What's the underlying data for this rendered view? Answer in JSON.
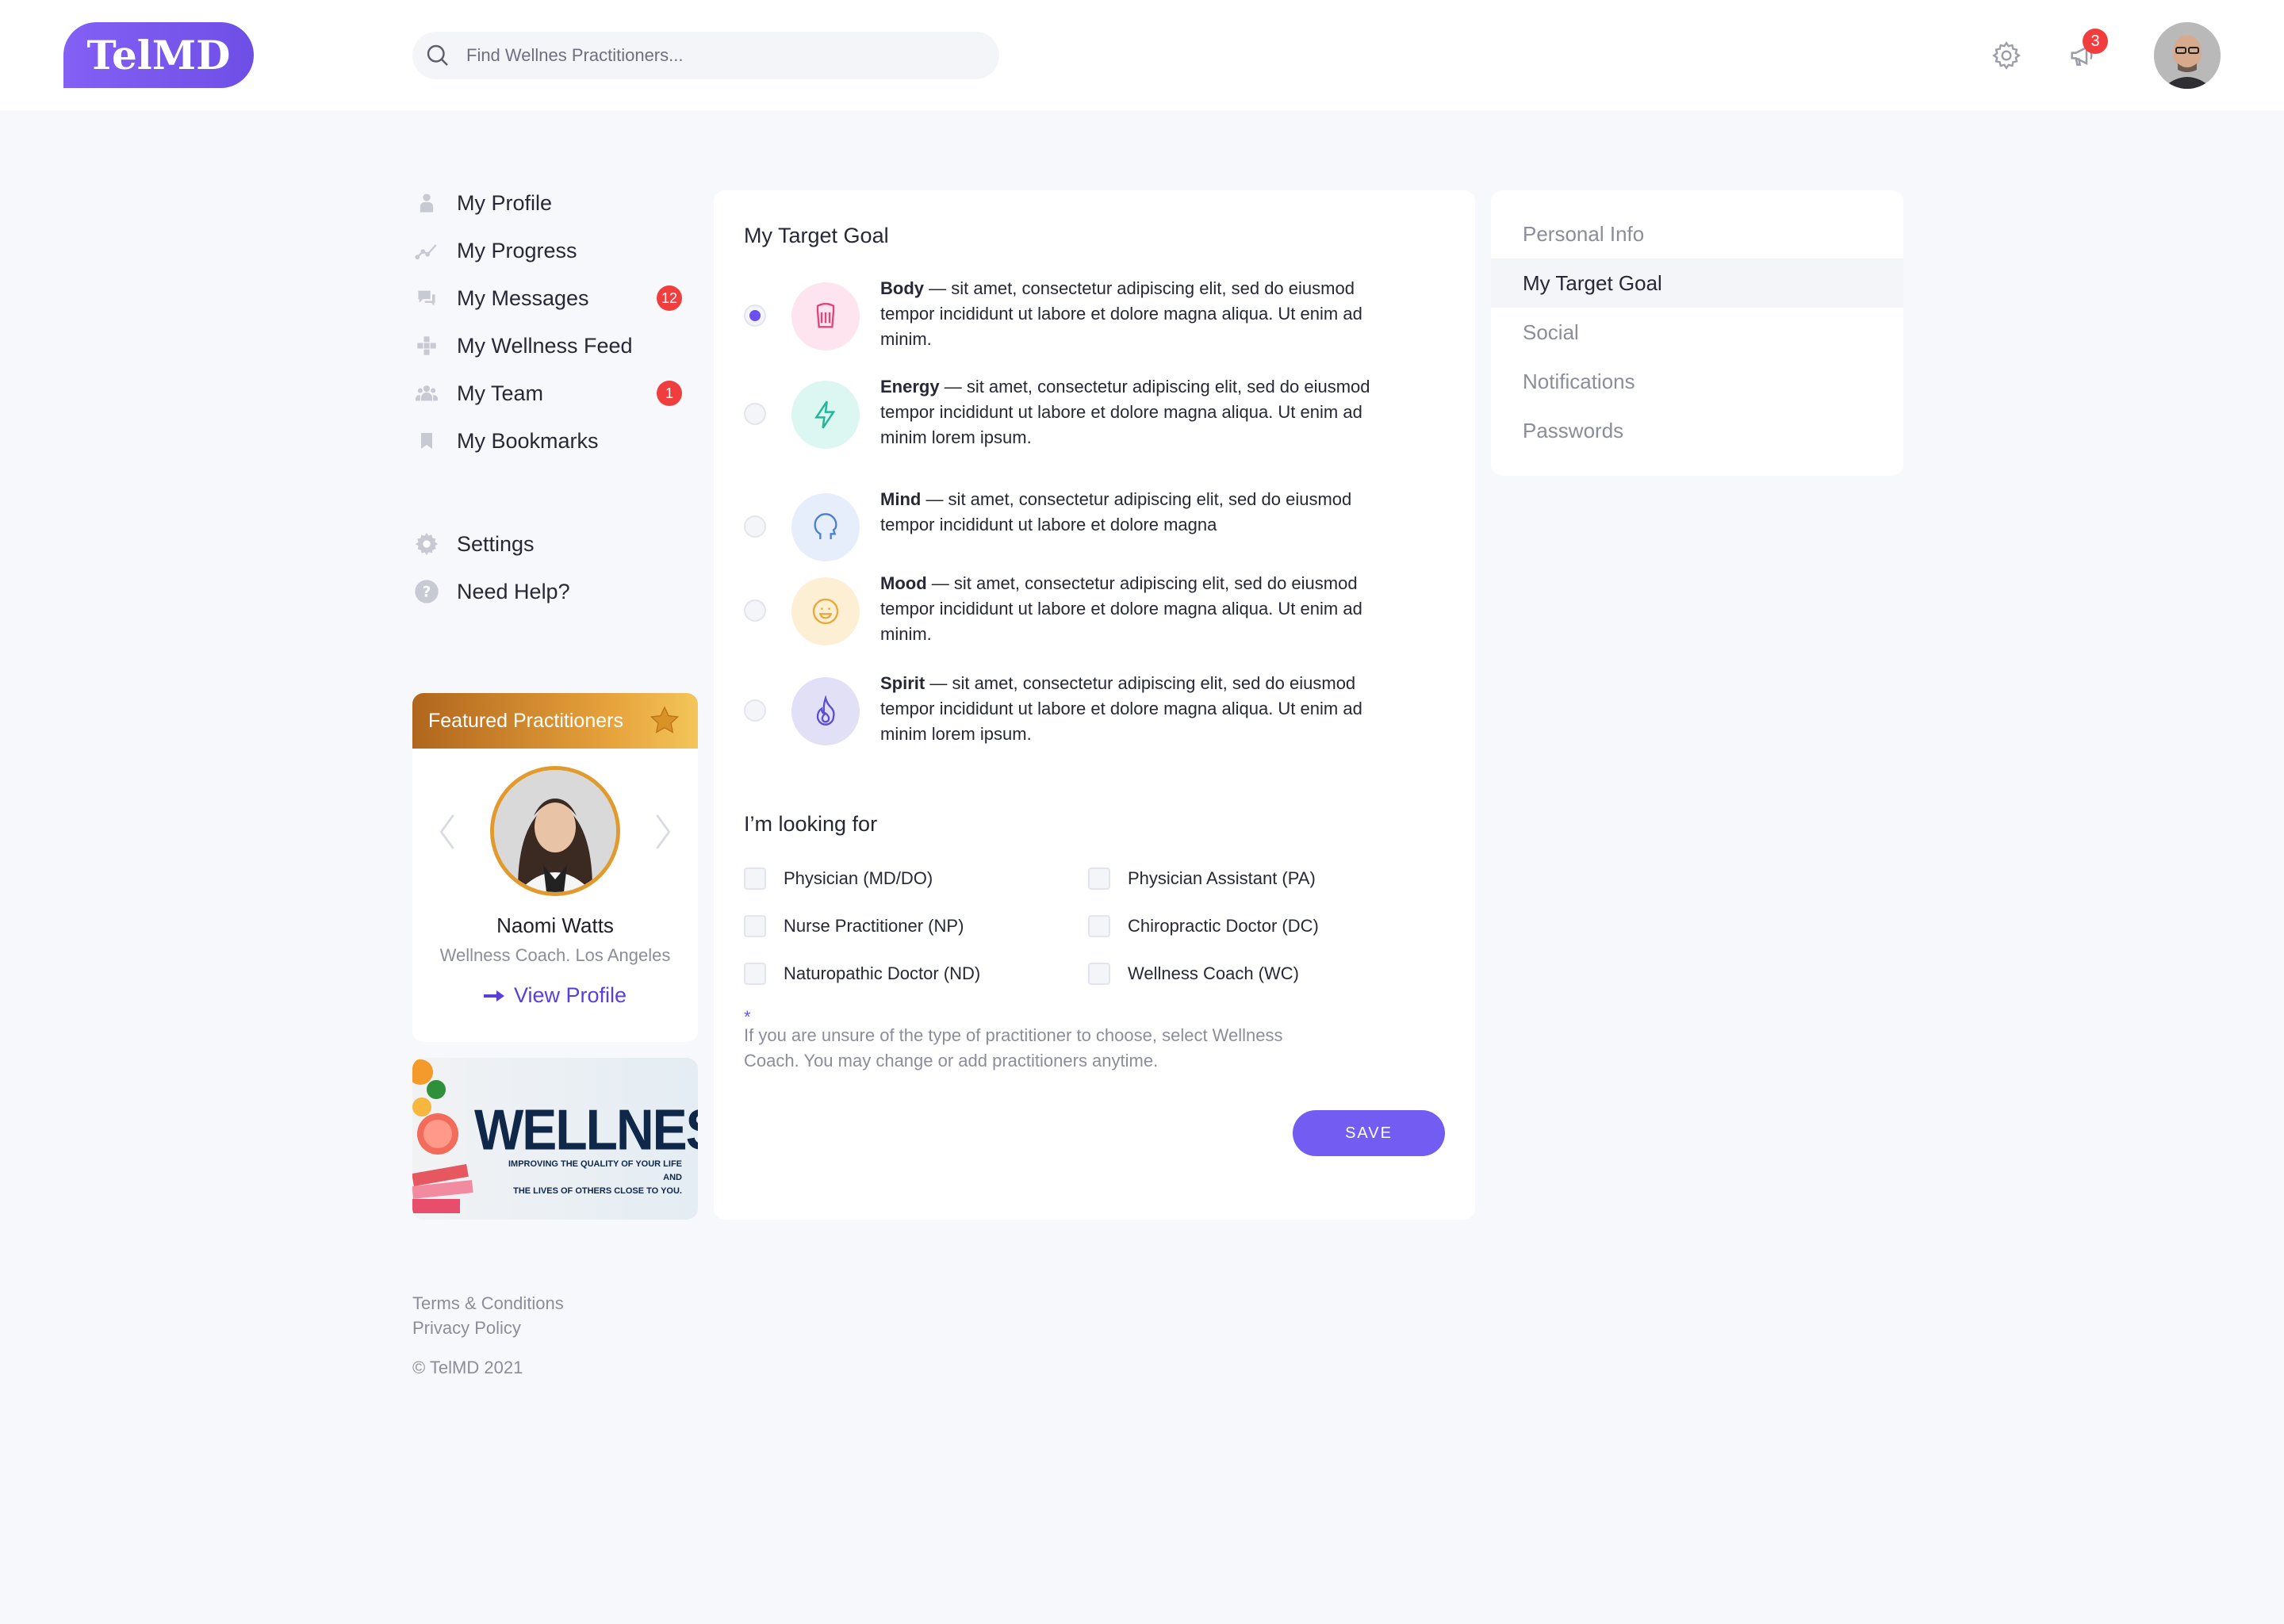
{
  "header": {
    "logo": "TelMD",
    "search_placeholder": "Find Wellnes Practitioners...",
    "notification_count": "3"
  },
  "nav": {
    "items": [
      {
        "label": "My Profile",
        "icon": "person-icon"
      },
      {
        "label": "My Progress",
        "icon": "chart-line-icon"
      },
      {
        "label": "My Messages",
        "icon": "chat-icon",
        "count": "12"
      },
      {
        "label": "My Wellness Feed",
        "icon": "feed-icon"
      },
      {
        "label": "My Team",
        "icon": "team-icon",
        "count": "1"
      },
      {
        "label": "My Bookmarks",
        "icon": "bookmark-icon"
      }
    ],
    "secondary": [
      {
        "label": "Settings",
        "icon": "gear-icon"
      },
      {
        "label": "Need Help?",
        "icon": "help-icon"
      }
    ]
  },
  "featured": {
    "title": "Featured Practitioners",
    "name": "Naomi Watts",
    "subtitle": "Wellness Coach. Los Angeles",
    "view_profile": "View Profile"
  },
  "banner": {
    "word": "WELLNESS",
    "tagline_1": "IMPROVING THE QUALITY OF YOUR LIFE AND",
    "tagline_2": "THE LIVES OF OTHERS CLOSE TO YOU."
  },
  "footer": {
    "terms": "Terms & Conditions",
    "privacy": "Privacy Policy",
    "copyright": "© TelMD 2021"
  },
  "main": {
    "title": "My Target Goal",
    "goals": [
      {
        "name": "Body",
        "text": " — sit amet, consectetur adipiscing elit, sed do eiusmod tempor incididunt ut labore et dolore magna aliqua. Ut enim ad minim.",
        "selected": true,
        "color": "#fde4ee",
        "accent": "#e0467e"
      },
      {
        "name": "Energy",
        "text": " — sit amet, consectetur adipiscing elit, sed do eiusmod tempor incididunt ut labore et dolore magna aliqua. Ut enim ad minim lorem ipsum.",
        "selected": false,
        "color": "#dcf7f1",
        "accent": "#21b89a"
      },
      {
        "name": "Mind",
        "text": " — sit amet, consectetur adipiscing elit, sed do eiusmod tempor incididunt ut labore et dolore magna",
        "selected": false,
        "color": "#e6eefc",
        "accent": "#4a7fd6"
      },
      {
        "name": "Mood",
        "text": " — sit amet, consectetur adipiscing elit, sed do eiusmod tempor incididunt ut labore et dolore magna aliqua. Ut enim ad minim.",
        "selected": false,
        "color": "#fdefd4",
        "accent": "#e8a83a"
      },
      {
        "name": "Spirit",
        "text": " — sit amet, consectetur adipiscing elit, sed do eiusmod tempor incididunt ut labore et dolore magna aliqua. Ut enim ad minim lorem ipsum.",
        "selected": false,
        "color": "#e1e0f6",
        "accent": "#5a4fcf"
      }
    ],
    "looking_title": "I’m looking for",
    "options": [
      "Physician (MD/DO)",
      "Physician Assistant (PA)",
      "Nurse Practitioner (NP)",
      "Chiropractic Doctor (DC)",
      "Naturopathic Doctor (ND)",
      "Wellness Coach (WC)"
    ],
    "note_star": "*",
    "note": "If you are unsure of the type of practitioner to choose, select Wellness Coach. You may change or add practitioners anytime.",
    "save": "SAVE"
  },
  "settings_nav": {
    "items": [
      "Personal Info",
      "My Target Goal",
      "Social",
      "Notifications",
      "Passwords"
    ],
    "active": "My Target Goal"
  },
  "colors": {
    "accent": "#735cf2",
    "badge": "#f03e3e",
    "gold": "#e19a2d"
  }
}
